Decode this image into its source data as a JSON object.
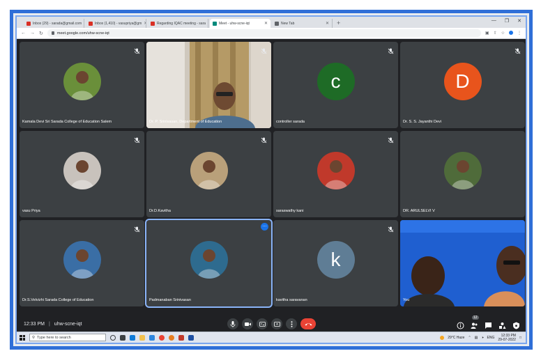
{
  "browser": {
    "tabs": [
      {
        "label": "Inbox (29) - sarada@gmail.com",
        "color": "#d93025",
        "active": false
      },
      {
        "label": "Inbox (1,410) - vasupriya@gm",
        "color": "#d93025",
        "active": false
      },
      {
        "label": "Regarding IQAC meeting - sara",
        "color": "#d93025",
        "active": false
      },
      {
        "label": "Meet - uhw-scne-iqt",
        "color": "#00897b",
        "active": true
      },
      {
        "label": "New Tab",
        "color": "#5f6368",
        "active": false
      }
    ],
    "new_tab_label": "+",
    "url": "meet.google.com/uhw-scne-iqt"
  },
  "participants": [
    {
      "name": "Kamala Devi Sri Sarada College of Education Salem",
      "type": "photo",
      "color": "#6a8f3a",
      "muted": true
    },
    {
      "name": "Dr. P. Srinivasan, Department of Education",
      "type": "video",
      "muted": true
    },
    {
      "name": "controller sarada",
      "type": "letter",
      "letter": "c",
      "color": "#1e6b26",
      "muted": true
    },
    {
      "name": "Dr. S. S. Jayanthi Devi",
      "type": "letter",
      "letter": "D",
      "color": "#e8541c",
      "muted": true
    },
    {
      "name": "vasu Priya",
      "type": "photo",
      "color": "#c8c2bc",
      "muted": true
    },
    {
      "name": "Dr.D.Kavitha",
      "type": "photo",
      "color": "#b9a07a",
      "muted": true
    },
    {
      "name": "saraswathy kani",
      "type": "photo",
      "color": "#c0392b",
      "muted": true
    },
    {
      "name": "DR. ARULSELVI V",
      "type": "photo",
      "color": "#4f6b3a",
      "muted": false
    },
    {
      "name": "Dr.S.Velvizhi Sarada College of Education",
      "type": "photo",
      "color": "#3a6ea5",
      "muted": true
    },
    {
      "name": "Padmanaban Srinivasan",
      "type": "photo",
      "color": "#2e6b8f",
      "muted": false,
      "speaking": true
    },
    {
      "name": "kavitha saravanan",
      "type": "letter",
      "letter": "k",
      "color": "#5f7d95",
      "muted": true
    },
    {
      "name": "You",
      "type": "self-video",
      "muted": false
    }
  ],
  "meeting": {
    "time": "12:33 PM",
    "separator": "|",
    "code": "uhw-scne-iqt",
    "people_count": "12"
  },
  "taskbar": {
    "search_placeholder": "Type here to search",
    "weather": "29°C Haze",
    "language": "ENG",
    "clock_time": "12:33 PM",
    "clock_date": "29-07-2022"
  }
}
